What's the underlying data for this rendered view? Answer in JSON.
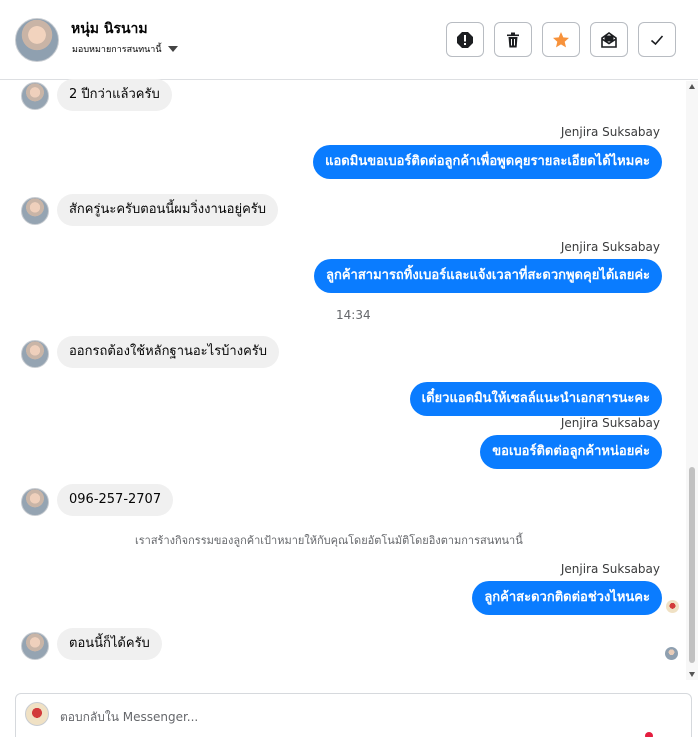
{
  "header": {
    "contact_name": "หนุ่ม นิรนาม",
    "assign_label": "มอบหมายการสนทนานี้",
    "actions": [
      {
        "name": "report-icon",
        "color": "#050505"
      },
      {
        "name": "trash-icon",
        "color": "#050505"
      },
      {
        "name": "star-icon",
        "color": "#f7923b"
      },
      {
        "name": "mark-unread-icon",
        "color": "#050505"
      },
      {
        "name": "check-icon",
        "color": "#050505"
      }
    ]
  },
  "thread": {
    "messages": [
      {
        "id": "m1",
        "direction": "in",
        "text": "2 ปีกว่าแล้วครับ"
      },
      {
        "id": "m2",
        "direction": "out",
        "sender": "Jenjira Suksabay",
        "text": "แอดมินขอเบอร์ติดต่อลูกค้าเพื่อพูดคุยรายละเอียดได้ไหมคะ"
      },
      {
        "id": "m3",
        "direction": "in",
        "text": "สักครู่นะครับตอนนี้ผมวิ่งงานอยู่ครับ"
      },
      {
        "id": "m4",
        "direction": "out",
        "sender": "Jenjira Suksabay",
        "text": "ลูกค้าสามารถทิ้งเบอร์และแจ้งเวลาที่สะดวกพูดคุยได้เลยค่ะ"
      },
      {
        "id": "t1",
        "direction": "time",
        "text": "14:34"
      },
      {
        "id": "m5",
        "direction": "in",
        "text": "ออกรถต้องใช้หลักฐานอะไรบ้างครับ"
      },
      {
        "id": "m6",
        "direction": "out",
        "text": "เดี๋ยวแอดมินให้เซลล์แนะนำเอกสารนะคะ"
      },
      {
        "id": "m7",
        "direction": "out",
        "sender": "Jenjira Suksabay",
        "text": "ขอเบอร์ติดต่อลูกค้าหน่อยค่ะ"
      },
      {
        "id": "m8",
        "direction": "in",
        "text": "096-257-2707"
      },
      {
        "id": "s1",
        "direction": "system",
        "text": "เราสร้างกิจกรรมของลูกค้าเป้าหมายให้กับคุณโดยอัตโนมัติโดยอิงตามการสนทนานี้"
      },
      {
        "id": "m9",
        "direction": "out",
        "sender": "Jenjira Suksabay",
        "text": "ลูกค้าสะดวกติดต่อช่วงไหนคะ"
      },
      {
        "id": "m10",
        "direction": "in",
        "text": "ตอนนี้ก็ได้ครับ"
      }
    ]
  },
  "composer": {
    "placeholder": "ตอบกลับใน Messenger..."
  },
  "colors": {
    "outgoing_bubble": "#0a7cff",
    "incoming_bubble": "#f0f0f0",
    "accent_star": "#f7923b"
  }
}
